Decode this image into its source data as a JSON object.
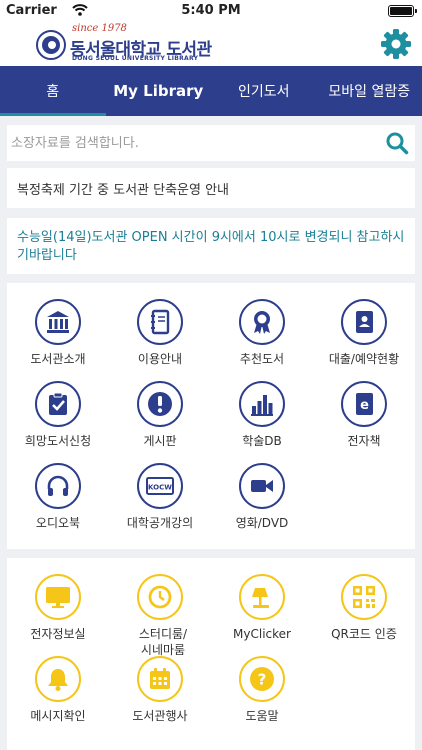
{
  "status_bar": {
    "carrier": "Carrier",
    "time": "5:40 PM"
  },
  "header": {
    "logo": {
      "since": "since 1978",
      "name": "동서울대학교 도서관",
      "subtitle": "DONG SEOUL UNIVERSITY   LIBRARY"
    },
    "settings_icon": "gear-icon"
  },
  "nav": {
    "tabs": [
      {
        "label": "홈",
        "active": true
      },
      {
        "label": "My Library",
        "active": false
      },
      {
        "label": "인기도서",
        "active": false
      },
      {
        "label": "모바일 열람증",
        "active": false
      }
    ]
  },
  "search": {
    "placeholder": "소장자료를 검색합니다.",
    "value": ""
  },
  "notices": [
    {
      "text": "복정축제 기간 중 도서관 단축운영 안내"
    },
    {
      "text": "수능일(14일)도서관 OPEN 시간이 9시에서 10시로 변경되니 참고하시기바랍니다"
    }
  ],
  "menu": {
    "items": [
      {
        "label": "도서관소개",
        "icon": "library-building-icon"
      },
      {
        "label": "이용안내",
        "icon": "notebook-icon"
      },
      {
        "label": "추천도서",
        "icon": "award-ribbon-icon"
      },
      {
        "label": "대출/예약현황",
        "icon": "contact-book-icon"
      },
      {
        "label": "희망도서신청",
        "icon": "clipboard-check-icon"
      },
      {
        "label": "게시판",
        "icon": "exclamation-icon"
      },
      {
        "label": "학술DB",
        "icon": "bar-chart-icon"
      },
      {
        "label": "전자책",
        "icon": "ebook-icon"
      },
      {
        "label": "오디오북",
        "icon": "headphones-icon"
      },
      {
        "label": "대학공개강의",
        "icon": "kocw-icon",
        "icon_text": "KOCW"
      },
      {
        "label": "영화/DVD",
        "icon": "video-camera-icon"
      }
    ]
  },
  "services": {
    "items": [
      {
        "label": "전자정보실",
        "icon": "monitor-icon"
      },
      {
        "label": "스터디룸/시네마룸",
        "icon": "clock-icon"
      },
      {
        "label": "MyClicker",
        "icon": "desk-lamp-icon"
      },
      {
        "label": "QR코드 인증",
        "icon": "qr-code-icon"
      },
      {
        "label": "메시지확인",
        "icon": "bell-icon"
      },
      {
        "label": "도서관행사",
        "icon": "calendar-icon"
      },
      {
        "label": "도움말",
        "icon": "help-icon"
      }
    ]
  },
  "colors": {
    "primary": "#2d3e8c",
    "accent": "#1e8fa0",
    "notice_highlight": "#1a7f96",
    "service_yellow": "#f5c518",
    "background": "#eef0f3"
  }
}
